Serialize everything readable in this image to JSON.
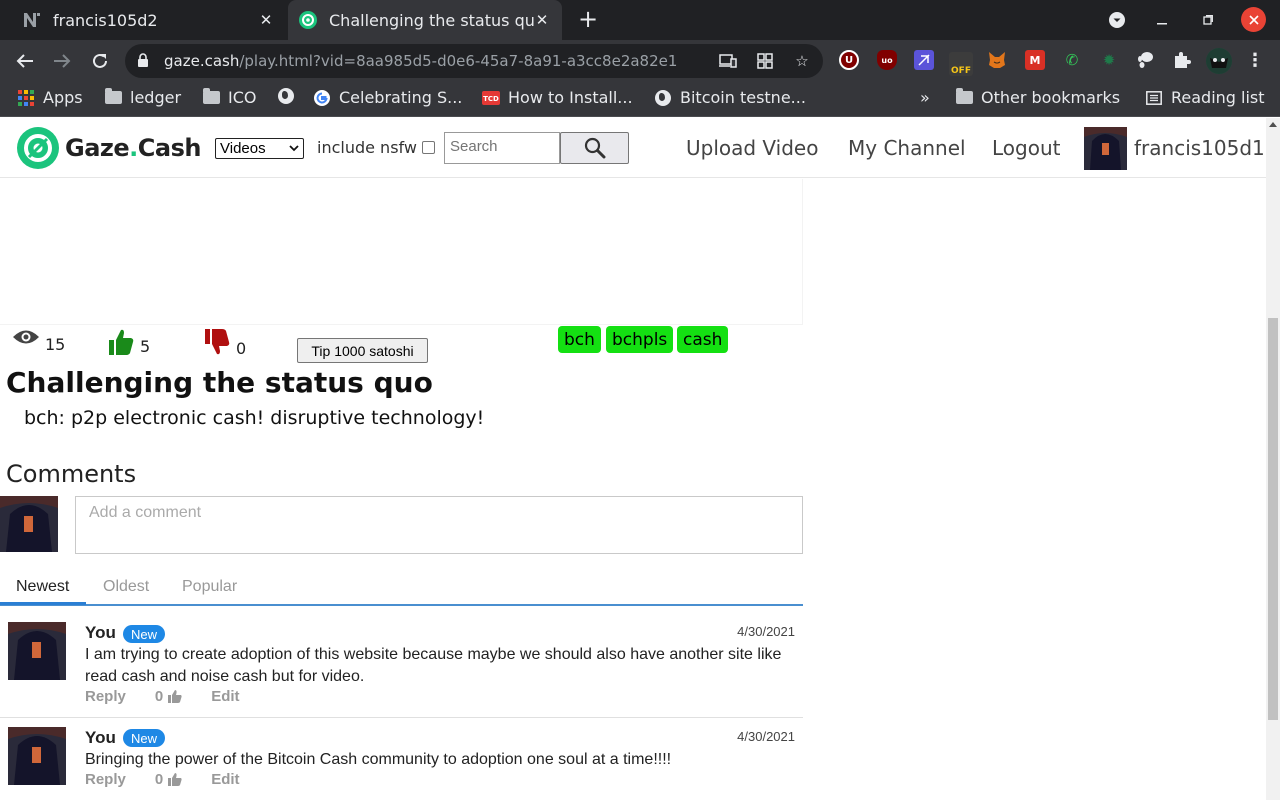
{
  "browser": {
    "tabs": [
      {
        "title": "francis105d2",
        "icon": "n-favicon"
      },
      {
        "title": "Challenging the status quo",
        "icon": "gaze-favicon",
        "active": true
      }
    ],
    "url_host": "gaze.cash",
    "url_path": "/play.html?vid=8aa985d5-d0e6-45a7-8a91-a3cc8e2a82e1",
    "bookmarks": [
      {
        "label": "Apps",
        "icon": "apps-grid-icon"
      },
      {
        "label": "ledger",
        "icon": "folder-icon"
      },
      {
        "label": "ICO",
        "icon": "folder-icon"
      },
      {
        "label": "",
        "icon": "globe-icon"
      },
      {
        "label": "Celebrating S...",
        "icon": "google-icon"
      },
      {
        "label": "How to Install...",
        "icon": "tcd-icon"
      },
      {
        "label": "Bitcoin testne...",
        "icon": "globe-icon"
      }
    ],
    "bookmarks_overflow": "»",
    "other_bookmarks": "Other bookmarks",
    "reading_list": "Reading list",
    "extensions": [
      "ublock-origin-icon",
      "ublock-icon",
      "feather-icon",
      "off-icon",
      "metamask-icon",
      "m-red-icon",
      "phone-icon",
      "bug-icon",
      "gnome-icon",
      "puzzle-icon",
      "profile-icon"
    ],
    "colors": {
      "tabbar": "#202124",
      "toolbar": "#35363a"
    }
  },
  "site": {
    "brand": {
      "prefix": "Gaze",
      "dot": ".",
      "suffix": "Cash"
    },
    "type_select": "Videos",
    "nsfw_label": "include nsfw",
    "search_placeholder": "Search",
    "nav": {
      "upload": "Upload Video",
      "channel": "My Channel",
      "logout": "Logout"
    },
    "username": "francis105d1",
    "accent": "#1bc47d"
  },
  "video": {
    "views": "15",
    "likes": "5",
    "dislikes": "0",
    "tip_label": "Tip 1000 satoshi",
    "tags": [
      "bch",
      "bchpls",
      "cash"
    ],
    "title": "Challenging the status quo",
    "description": "bch: p2p electronic cash! disruptive technology!"
  },
  "comments": {
    "heading": "Comments",
    "placeholder": "Add a comment",
    "tabs": [
      "Newest",
      "Oldest",
      "Popular"
    ],
    "items": [
      {
        "author": "You",
        "badge": "New",
        "date": "4/30/2021",
        "text": "I am trying to create adoption of this website because maybe we should also have another site like read cash and noise cash but for video.",
        "reply": "Reply",
        "likes": "0",
        "edit": "Edit"
      },
      {
        "author": "You",
        "badge": "New",
        "date": "4/30/2021",
        "text": "Bringing the power of the Bitcoin Cash community to adoption one soul at a time!!!!",
        "reply": "Reply",
        "likes": "0",
        "edit": "Edit"
      }
    ]
  }
}
